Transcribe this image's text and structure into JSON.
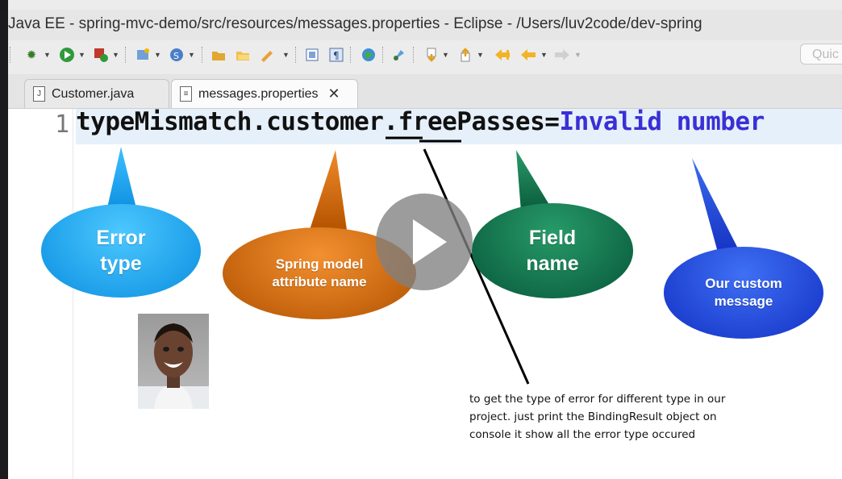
{
  "window": {
    "title": "Java EE - spring-mvc-demo/src/resources/messages.properties - Eclipse - /Users/luv2code/dev-spring"
  },
  "toolbar": {
    "quick_access_placeholder": "Quic"
  },
  "tabs": [
    {
      "label": "Customer.java",
      "icon": "java-file-icon",
      "active": false
    },
    {
      "label": "messages.properties",
      "icon": "properties-file-icon",
      "active": true,
      "close_icon": "close-icon"
    }
  ],
  "editor": {
    "line_number": "1",
    "key_part1": "typeMismatch",
    "dot1": ".",
    "key_part2": "customer",
    "dot2": ".",
    "key_part3": "freePasses",
    "equals": "=",
    "value": "Invalid number"
  },
  "callouts": {
    "error_type": "Error type",
    "model_attribute": "Spring model attribute name",
    "field_name": "Field name",
    "custom_message": "Our custom message"
  },
  "annotation_note": "to get the type of error for different type in our project. just print the BindingResult object on console it show all the error type occured",
  "colors": {
    "error_type_bubble": "#1aa6ec",
    "model_attribute_bubble": "#d5690f",
    "field_name_bubble": "#0f6e4c",
    "custom_message_bubble": "#1a4fe0",
    "property_value": "#3a2fd6"
  }
}
